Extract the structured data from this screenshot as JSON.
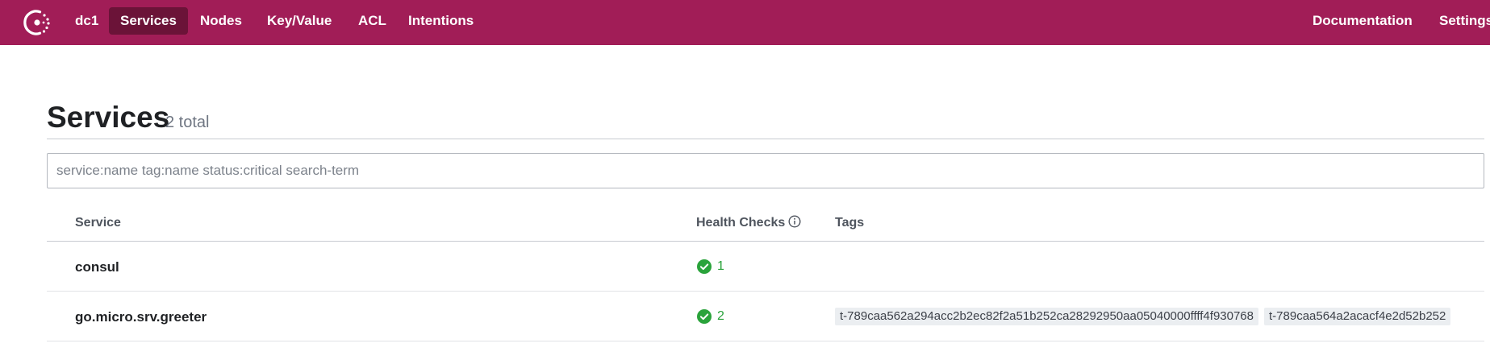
{
  "nav": {
    "datacenter": "dc1",
    "items": [
      "Services",
      "Nodes",
      "Key/Value",
      "ACL",
      "Intentions"
    ],
    "active": "Services",
    "right": [
      "Documentation",
      "Settings"
    ]
  },
  "page": {
    "title": "Services",
    "count": "2 total"
  },
  "search": {
    "placeholder": "service:name tag:name status:critical search-term",
    "value": ""
  },
  "table": {
    "columns": [
      "Service",
      "Health Checks",
      "Tags"
    ],
    "rows": [
      {
        "service": "consul",
        "checks": "1",
        "tags": []
      },
      {
        "service": "go.micro.srv.greeter",
        "checks": "2",
        "tags": [
          "t-789caa562a294acc2b2ec82f2a51b252ca28292950aa05040000ffff4f930768",
          "t-789caa564a2acacf4e2d52b252"
        ]
      }
    ]
  },
  "colors": {
    "brand": "#a11d57",
    "active_nav": "#6b1338",
    "passing": "#2aa33b"
  },
  "icons": {
    "logo": "consul-logo-icon",
    "info": "info-icon",
    "check": "check-circle-icon"
  }
}
